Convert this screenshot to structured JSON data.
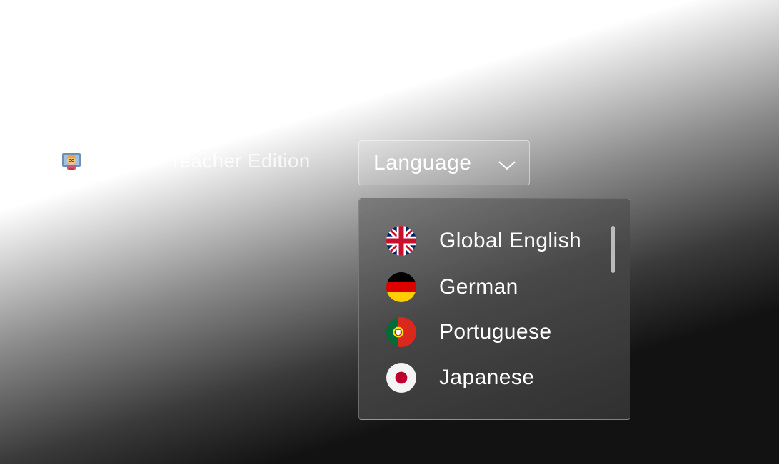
{
  "teacher": {
    "icon": "teacher-emoji-icon",
    "text": "Summer Teacher Edition"
  },
  "language_select": {
    "label": "Language",
    "icon": "chevron-down-icon"
  },
  "dropdown": {
    "options": [
      {
        "label": "Global English",
        "flag": "uk-flag-icon"
      },
      {
        "label": "German",
        "flag": "germany-flag-icon"
      },
      {
        "label": "Portuguese",
        "flag": "portugal-flag-icon"
      },
      {
        "label": "Japanese",
        "flag": "japan-flag-icon"
      }
    ]
  },
  "colors": {
    "uk_blue": "#012169",
    "uk_red": "#C8102E",
    "de_black": "#000000",
    "de_red": "#DD0000",
    "de_gold": "#FFCE00",
    "pt_green": "#046A38",
    "pt_red": "#DA291C",
    "jp_red": "#BC002D"
  }
}
